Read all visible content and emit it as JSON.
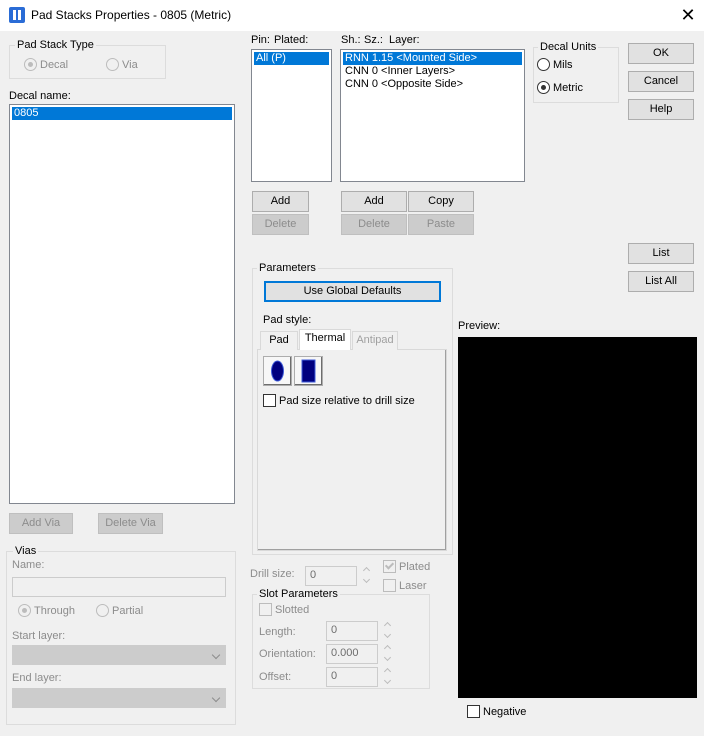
{
  "window": {
    "title": "Pad Stacks Properties - 0805 (Metric)"
  },
  "pad_stack_type": {
    "group_label": "Pad Stack Type",
    "options": [
      "Decal",
      "Via"
    ],
    "selected": "Decal"
  },
  "decal": {
    "label": "Decal name:",
    "items": [
      "0805"
    ],
    "selected": "0805"
  },
  "decal_buttons": {
    "add_via": "Add Via",
    "delete_via": "Delete Via"
  },
  "vias": {
    "group_label": "Vias",
    "name_label": "Name:",
    "name_value": "",
    "options": [
      "Through",
      "Partial"
    ],
    "selected": "Through",
    "start_layer_label": "Start layer:",
    "end_layer_label": "End layer:"
  },
  "pin_list": {
    "header_pin": "Pin:",
    "header_plated": "Plated:",
    "items": [
      "All (P)"
    ],
    "selected": "All (P)",
    "add": "Add",
    "delete": "Delete"
  },
  "layer_list": {
    "header_sh": "Sh.:",
    "header_sz": "Sz.:",
    "header_layer": "Layer:",
    "items": [
      "RNN 1.15 <Mounted Side>",
      "CNN 0 <Inner Layers>",
      "CNN 0 <Opposite Side>"
    ],
    "selected": "RNN 1.15 <Mounted Side>",
    "add": "Add",
    "copy": "Copy",
    "delete": "Delete",
    "paste": "Paste"
  },
  "decal_units": {
    "group_label": "Decal Units",
    "options": [
      "Mils",
      "Metric"
    ],
    "selected": "Metric"
  },
  "dialog_buttons": {
    "ok": "OK",
    "cancel": "Cancel",
    "help": "Help",
    "list": "List",
    "list_all": "List All"
  },
  "parameters": {
    "group_label": "Parameters",
    "use_global_defaults": "Use Global Defaults",
    "pad_style_label": "Pad style:",
    "tabs": [
      "Pad",
      "Thermal",
      "Antipad"
    ],
    "active_tab": "Thermal",
    "pad_size_relative": "Pad size relative to drill size",
    "pad_size_relative_checked": false
  },
  "drill": {
    "label": "Drill size:",
    "value": "0",
    "plated_label": "Plated",
    "plated_checked": true,
    "laser_label": "Laser",
    "laser_checked": false
  },
  "slot": {
    "group_label": "Slot Parameters",
    "slotted_label": "Slotted",
    "length_label": "Length:",
    "length_value": "0",
    "orientation_label": "Orientation:",
    "orientation_value": "0.000",
    "offset_label": "Offset:",
    "offset_value": "0"
  },
  "preview": {
    "label": "Preview:",
    "negative_label": "Negative",
    "background": "#000000"
  },
  "colors": {
    "selection": "#0078d7",
    "pad_fill": "#00007f"
  }
}
